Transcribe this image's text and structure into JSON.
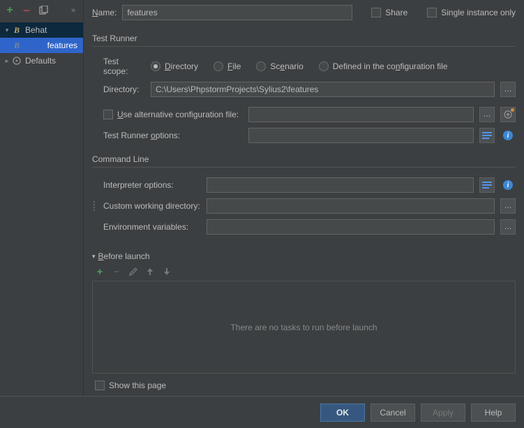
{
  "top": {
    "name_label": "Name:",
    "name_value": "features",
    "share": "Share",
    "single_instance": "Single instance only"
  },
  "tree": {
    "behat": "Behat",
    "features": "features",
    "defaults": "Defaults"
  },
  "test_runner": {
    "title": "Test Runner",
    "scope_label": "Test scope:",
    "scope_directory": "Directory",
    "scope_file": "File",
    "scope_scenario": "Scenario",
    "scope_config": "Defined in the configuration file",
    "directory_label": "Directory:",
    "directory_value": "C:\\Users\\PhpstormProjects\\Sylius2\\features",
    "alt_config": "Use alternative configuration file:",
    "options_label": "Test Runner options:"
  },
  "command_line": {
    "title": "Command Line",
    "interpreter": "Interpreter options:",
    "cwd": "Custom working directory:",
    "env": "Environment variables:"
  },
  "before_launch": {
    "title": "Before launch",
    "empty": "There are no tasks to run before launch",
    "show_page": "Show this page"
  },
  "buttons": {
    "ok": "OK",
    "cancel": "Cancel",
    "apply": "Apply",
    "help": "Help"
  }
}
